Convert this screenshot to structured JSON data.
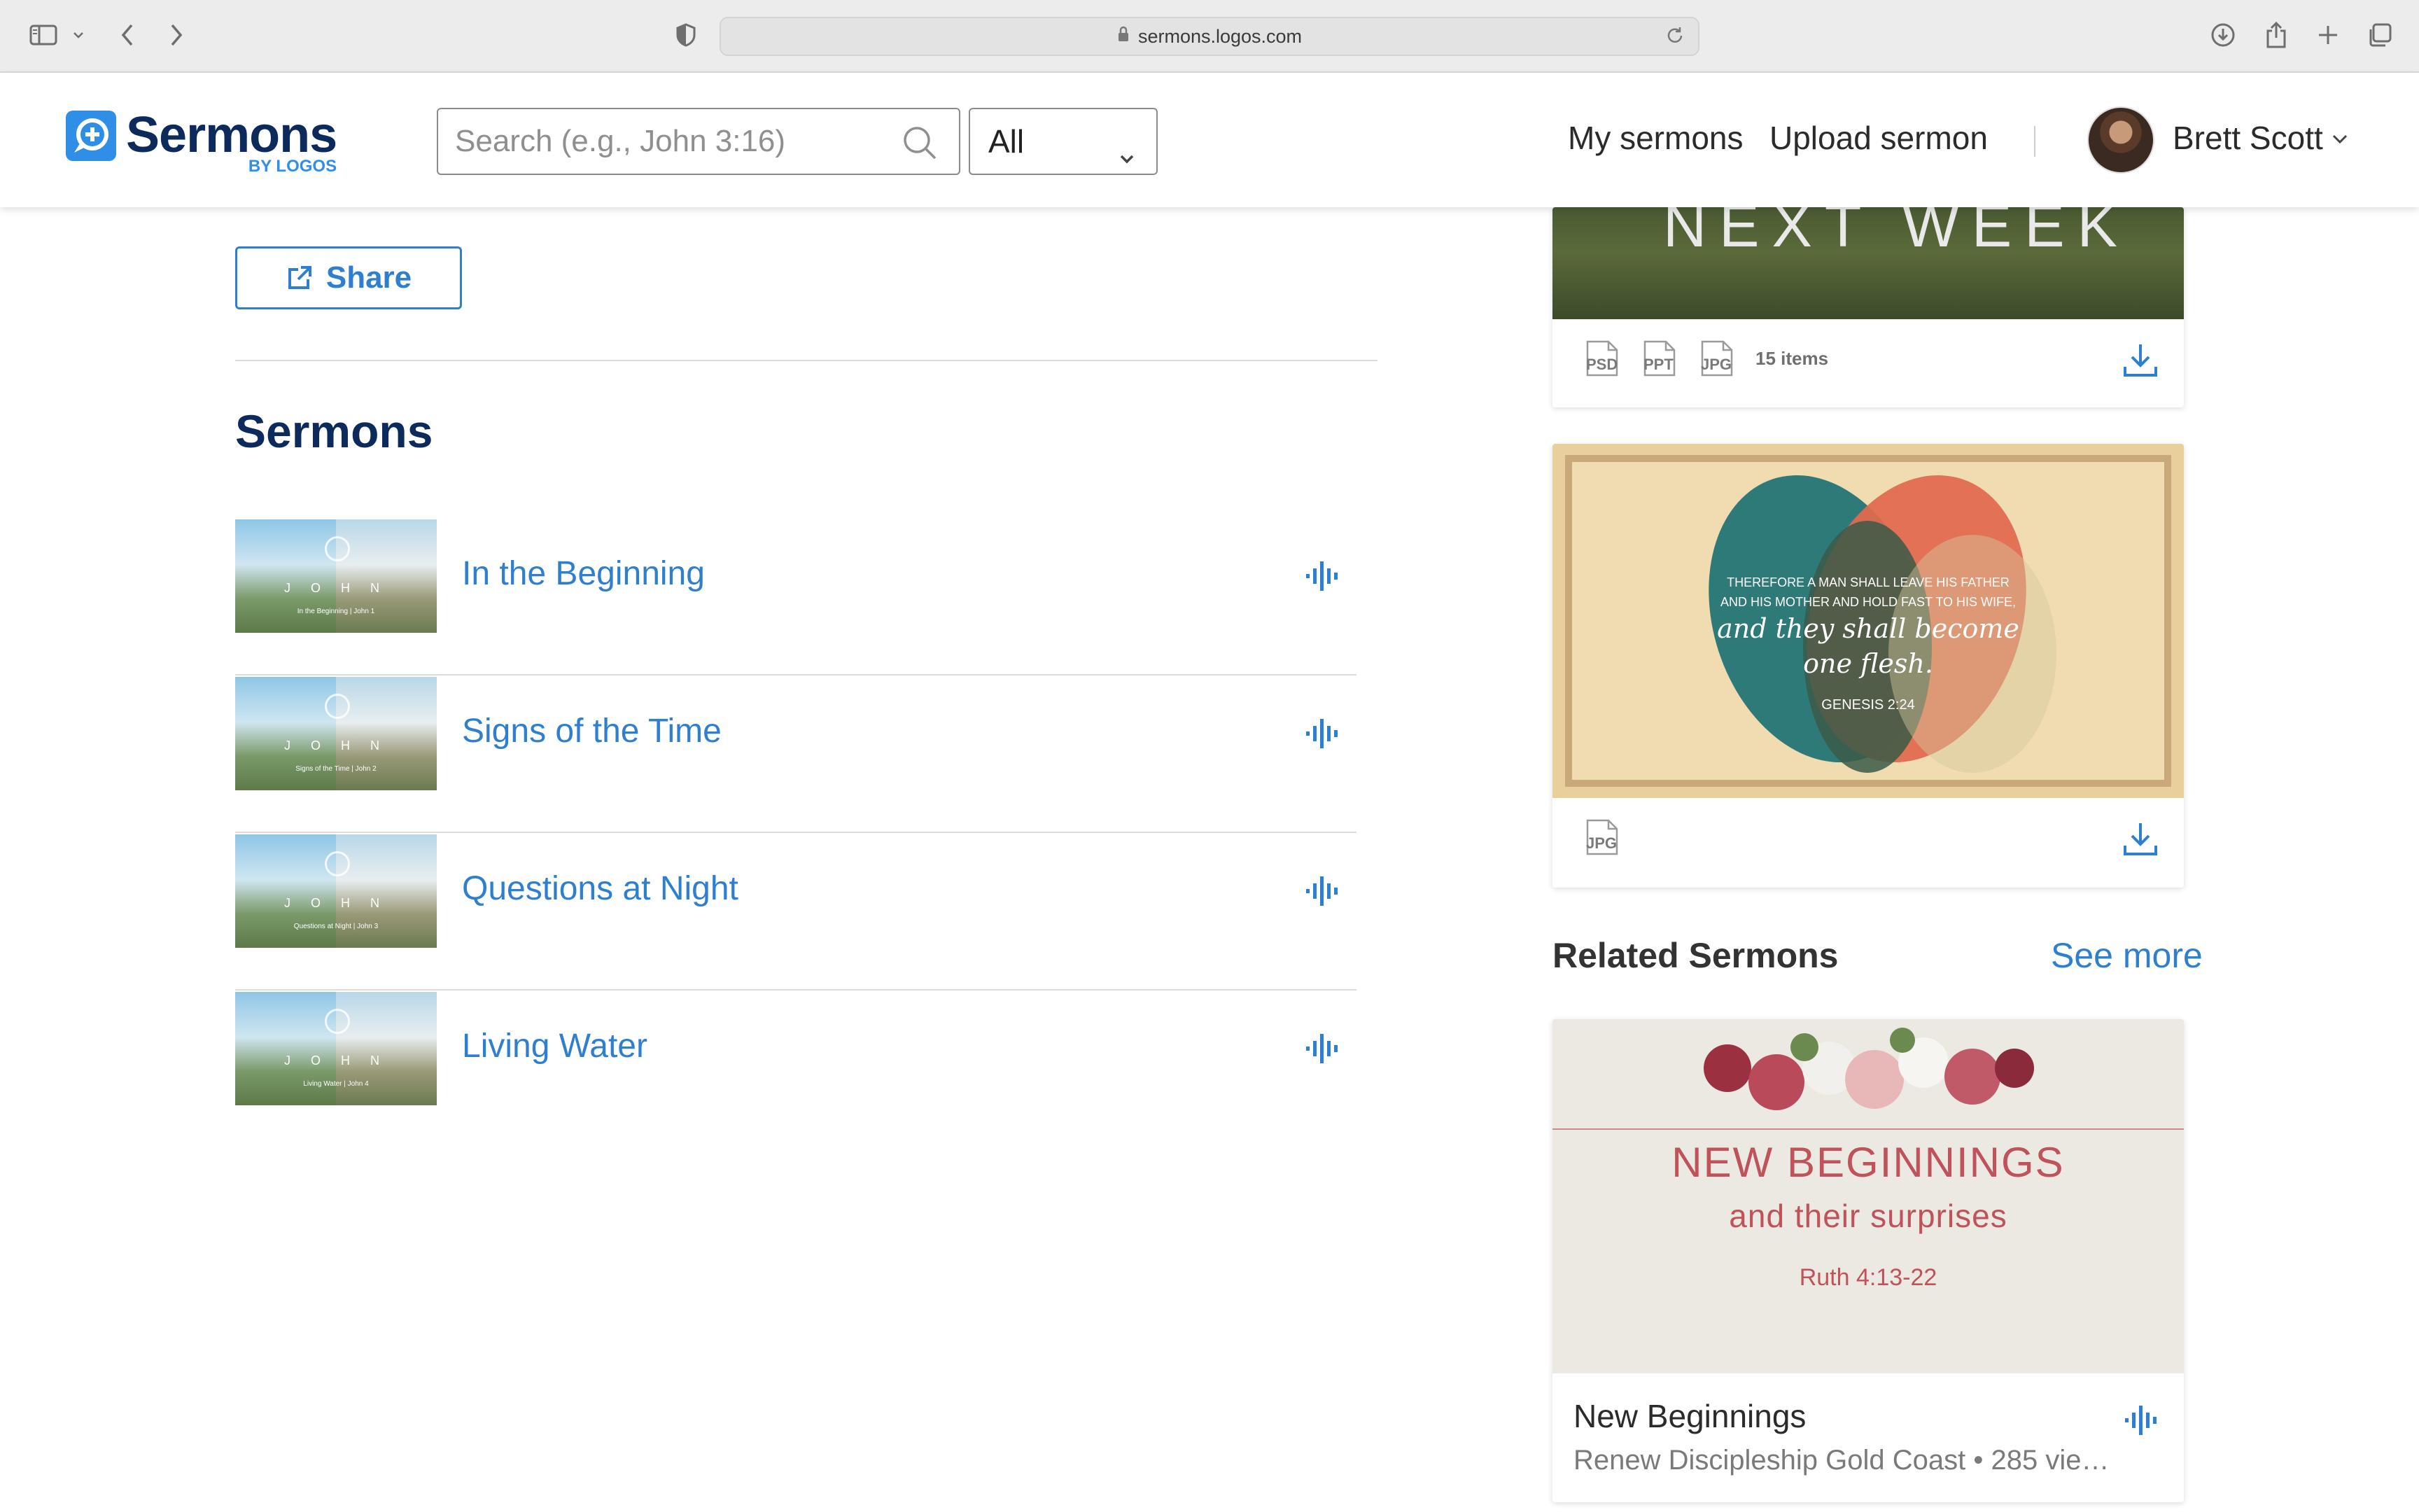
{
  "browser": {
    "url": "sermons.logos.com"
  },
  "header": {
    "logo_word": "Sermons",
    "logo_sub": "BY LOGOS",
    "search_placeholder": "Search (e.g., John 3:16)",
    "scope_value": "All",
    "nav": {
      "my_sermons": "My sermons",
      "upload_sermon": "Upload sermon"
    },
    "user_name": "Brett Scott"
  },
  "main": {
    "share_label": "Share",
    "section_title": "Sermons",
    "sermons": [
      {
        "title": "In the Beginning",
        "thumb_word": "J O H N",
        "thumb_caption": "In the Beginning | John 1"
      },
      {
        "title": "Signs of the Time",
        "thumb_word": "J O H N",
        "thumb_caption": "Signs of the Time | John 2"
      },
      {
        "title": "Questions at Night",
        "thumb_word": "J O H N",
        "thumb_caption": "Questions at Night | John 3"
      },
      {
        "title": "Living Water",
        "thumb_word": "J O H N",
        "thumb_caption": "Living Water | John 4"
      }
    ]
  },
  "sidebar": {
    "media_card_1": {
      "image_word": "NEXT WEEK",
      "file_types": [
        "PSD",
        "PPT",
        "JPG"
      ],
      "items_count": "15 items"
    },
    "media_card_2": {
      "verse_line_1": "THEREFORE A MAN SHALL LEAVE HIS FATHER",
      "verse_line_2": "AND HIS MOTHER AND HOLD FAST TO HIS WIFE,",
      "verse_line_3": "and they shall become",
      "verse_line_4": "one flesh.",
      "verse_ref": "GENESIS 2:24",
      "file_types": [
        "JPG"
      ]
    },
    "related": {
      "title": "Related Sermons",
      "see_more": "See more",
      "card": {
        "image_title": "NEW BEGINNINGS",
        "image_subtitle": "and their surprises",
        "image_ref": "Ruth 4:13-22",
        "title": "New Beginnings",
        "meta": "Renew Discipleship Gold Coast • 285 vie…"
      }
    }
  },
  "colors": {
    "brand_navy": "#0d2a5c",
    "link_blue": "#2f7fd0",
    "accent_blue": "#2f8ee6"
  }
}
